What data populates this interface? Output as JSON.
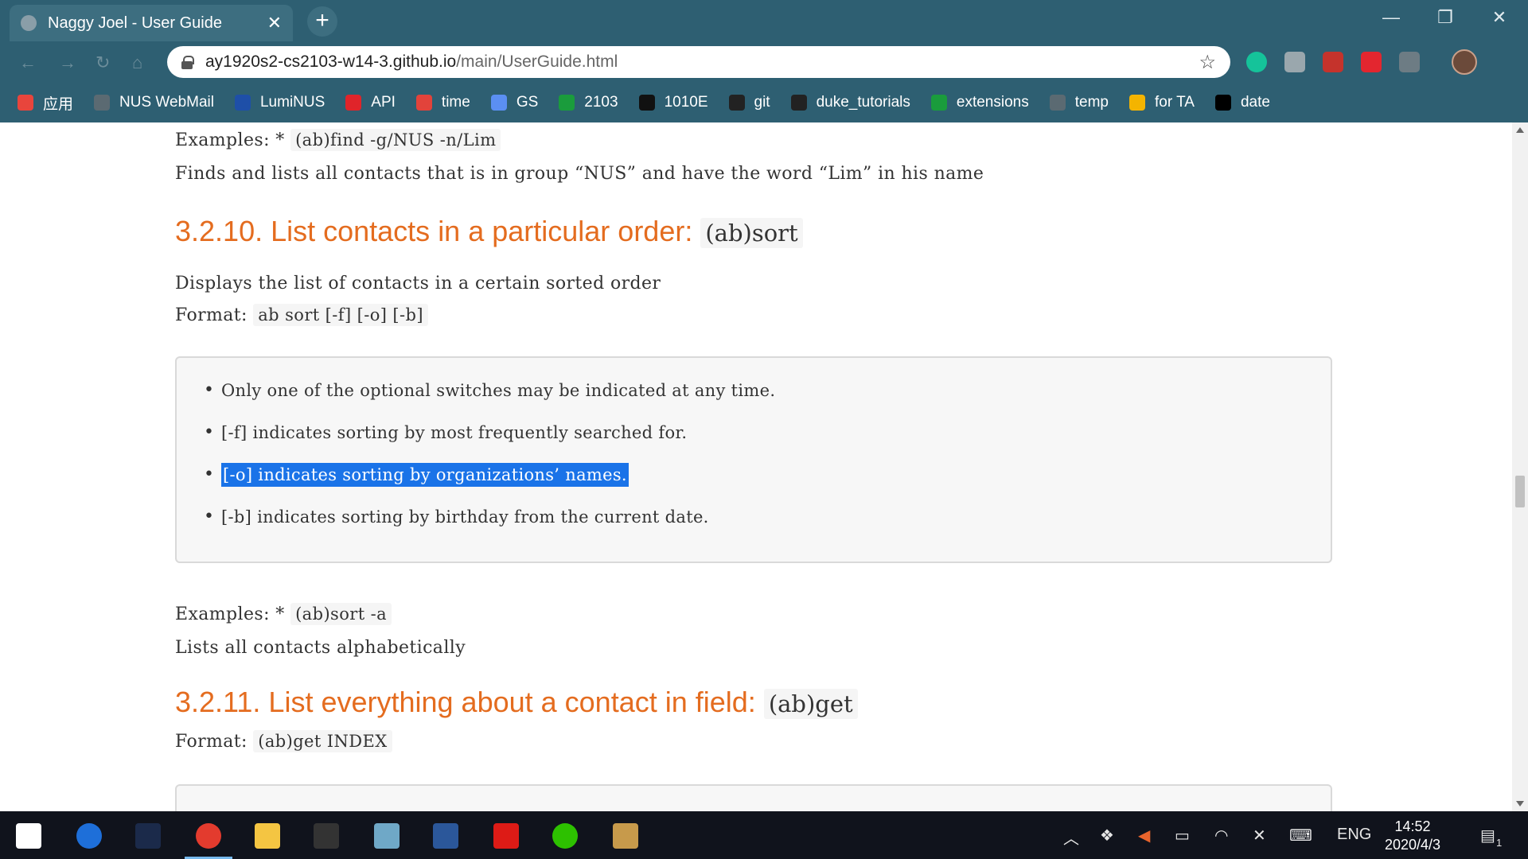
{
  "browser": {
    "tab_title": "Naggy Joel - User Guide",
    "tab_close": "✕",
    "new_tab": "+",
    "url_host": "ay1920s2-cs2103-w14-3.github.io",
    "url_path": "/main/UserGuide.html",
    "window_controls": {
      "minimize": "—",
      "restore": "❐",
      "close": "✕"
    },
    "bookmarks": [
      {
        "label": "应用",
        "color": "#e8453c"
      },
      {
        "label": "NUS WebMail",
        "color": "#5b6a72"
      },
      {
        "label": "LumiNUS",
        "color": "#1e4fa8"
      },
      {
        "label": "API",
        "color": "#e0242a"
      },
      {
        "label": "time",
        "color": "#e2433b"
      },
      {
        "label": "GS",
        "color": "#5b8ff2"
      },
      {
        "label": "2103",
        "color": "#1a9c3c"
      },
      {
        "label": "1010E",
        "color": "#111111"
      },
      {
        "label": "git",
        "color": "#222222"
      },
      {
        "label": "duke_tutorials",
        "color": "#222222"
      },
      {
        "label": "extensions",
        "color": "#1a9c3c"
      },
      {
        "label": "temp",
        "color": "#5b6a72"
      },
      {
        "label": "for TA",
        "color": "#f4b400"
      },
      {
        "label": "date",
        "color": "#000000"
      }
    ]
  },
  "doc": {
    "find_example_label": "Examples: *",
    "find_example_code": "(ab)find -g/NUS -n/Lim",
    "find_example_desc": "Finds and lists all contacts that is in group “NUS” and have the word “Lim” in his name",
    "sort_heading": "3.2.10. List contacts in a particular order:",
    "sort_heading_code": "(ab)sort",
    "sort_desc": "Displays the list of contacts in a certain sorted order",
    "sort_format_label": "Format:",
    "sort_format_code": "ab sort [-f] [-o] [-b]",
    "sort_notes": [
      {
        "code": "",
        "text": "Only one of the optional switches may be indicated at any time."
      },
      {
        "code": "[-f]",
        "text": " indicates sorting by most frequently searched for."
      },
      {
        "code": "[-o]",
        "text": " indicates sorting by organizations’ names."
      },
      {
        "code": "[-b]",
        "text": " indicates sorting by birthday from the current date."
      }
    ],
    "sort_example_label": "Examples: *",
    "sort_example_code": "(ab)sort -a",
    "sort_example_desc": "Lists all contacts alphabetically",
    "get_heading": "3.2.11. List everything about a contact in field:",
    "get_heading_code": "(ab)get",
    "get_format_label": "Format:",
    "get_format_code": "(ab)get INDEX"
  },
  "taskbar": {
    "lang": "ENG",
    "time": "14:52",
    "date": "2020/4/3",
    "notification_count": "1",
    "apps": [
      {
        "name": "start",
        "color": "#ffffff"
      },
      {
        "name": "maps",
        "color": "#1e6fd9"
      },
      {
        "name": "photoshop",
        "color": "#1b2a4a"
      },
      {
        "name": "chrome",
        "color": "#e33b2e"
      },
      {
        "name": "explorer",
        "color": "#f4c542"
      },
      {
        "name": "terminal",
        "color": "#333333"
      },
      {
        "name": "notes",
        "color": "#6fa8c7"
      },
      {
        "name": "word",
        "color": "#2b579a"
      },
      {
        "name": "angular",
        "color": "#dd1b16"
      },
      {
        "name": "wechat",
        "color": "#2dc100"
      },
      {
        "name": "contacts",
        "color": "#c79a4b"
      }
    ]
  }
}
